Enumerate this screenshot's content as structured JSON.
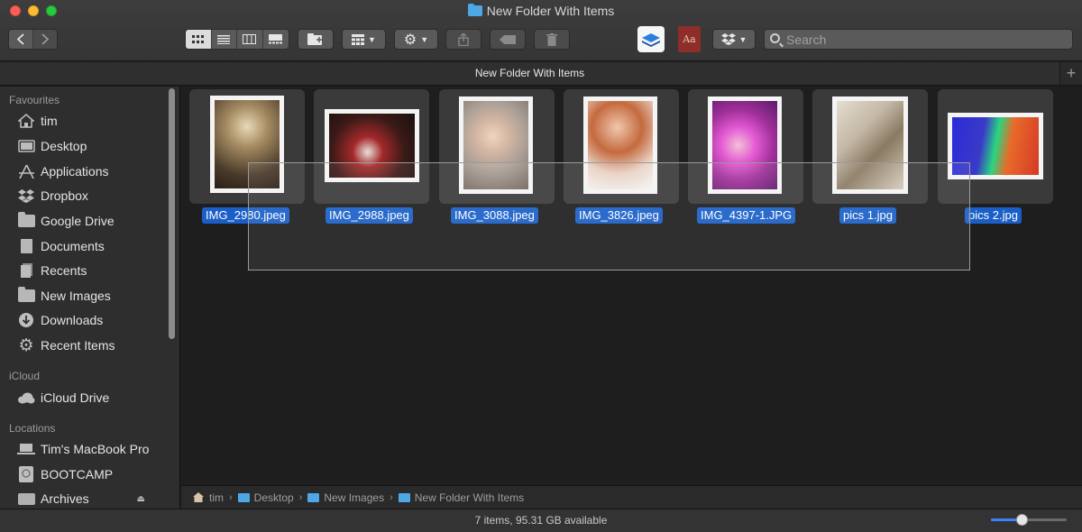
{
  "window": {
    "title": "New Folder With Items"
  },
  "toolbar": {
    "view_buttons": [
      "icon-view",
      "list-view",
      "column-view",
      "gallery-view"
    ],
    "active_view": "icon-view"
  },
  "search": {
    "placeholder": "Search",
    "value": ""
  },
  "tabs": [
    {
      "label": "New Folder With Items"
    }
  ],
  "sidebar": {
    "sections": [
      {
        "header": "Favourites",
        "items": [
          {
            "label": "tim",
            "icon": "home-icon"
          },
          {
            "label": "Desktop",
            "icon": "desktop-icon"
          },
          {
            "label": "Applications",
            "icon": "applications-icon"
          },
          {
            "label": "Dropbox",
            "icon": "dropbox-icon"
          },
          {
            "label": "Google Drive",
            "icon": "folder-icon"
          },
          {
            "label": "Documents",
            "icon": "documents-icon"
          },
          {
            "label": "Recents",
            "icon": "recents-icon"
          },
          {
            "label": "New Images",
            "icon": "folder-icon"
          },
          {
            "label": "Downloads",
            "icon": "downloads-icon"
          },
          {
            "label": "Recent Items",
            "icon": "gear-icon"
          }
        ]
      },
      {
        "header": "iCloud",
        "items": [
          {
            "label": "iCloud Drive",
            "icon": "cloud-icon"
          }
        ]
      },
      {
        "header": "Locations",
        "items": [
          {
            "label": "Tim's MacBook Pro",
            "icon": "laptop-icon"
          },
          {
            "label": "BOOTCAMP",
            "icon": "disk-icon"
          },
          {
            "label": "Archives",
            "icon": "disk-icon"
          }
        ]
      }
    ]
  },
  "files": [
    {
      "name": "IMG_2980.jpeg",
      "orientation": "portrait",
      "colors": [
        "#6b5a45",
        "#d7c7a6",
        "#3b2e22"
      ]
    },
    {
      "name": "IMG_2988.jpeg",
      "orientation": "landscape",
      "colors": [
        "#2a1b18",
        "#8a1f1f",
        "#c9a07a"
      ]
    },
    {
      "name": "IMG_3088.jpeg",
      "orientation": "portrait",
      "colors": [
        "#b6aaa1",
        "#e6cdbb",
        "#7b6f66"
      ]
    },
    {
      "name": "IMG_3826.jpeg",
      "orientation": "portrait",
      "colors": [
        "#c26a3e",
        "#e9c4ad",
        "#f0f0f0"
      ]
    },
    {
      "name": "IMG_4397-1.JPG",
      "orientation": "portrait",
      "colors": [
        "#a0309a",
        "#e35ad3",
        "#5b1b69"
      ]
    },
    {
      "name": "pics 1.jpg",
      "orientation": "portrait",
      "colors": [
        "#c4b8a6",
        "#8a7a62",
        "#e5ddd0"
      ]
    },
    {
      "name": "pics 2.jpg",
      "orientation": "landscape",
      "colors": [
        "#2a2bd8",
        "#e86b2a",
        "#28d680"
      ]
    }
  ],
  "pathbar": [
    {
      "label": "tim",
      "icon": "home-icon"
    },
    {
      "label": "Desktop",
      "icon": "folder-icon"
    },
    {
      "label": "New Images",
      "icon": "folder-icon"
    },
    {
      "label": "New Folder With Items",
      "icon": "folder-icon"
    }
  ],
  "status": {
    "text": "7 items, 95.31 GB available",
    "icon_size_fraction": 0.42
  },
  "colors": {
    "selection": "#1a5fc7",
    "accent": "#3b82f6"
  }
}
